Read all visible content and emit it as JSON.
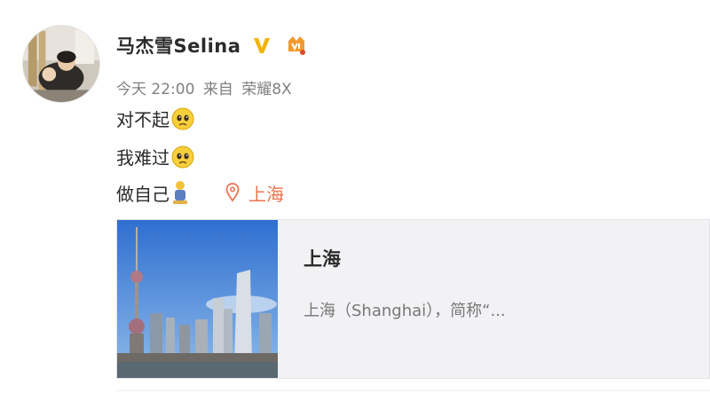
{
  "post": {
    "username": "马杰雪Selina",
    "meta": {
      "time": "今天 22:00",
      "source_prefix": "来自",
      "device": "荣耀8X"
    },
    "lines": [
      {
        "text": "对不起",
        "emoji": "sad-face-emoji"
      },
      {
        "text": "我难过",
        "emoji": "sad-face-emoji"
      },
      {
        "text": "做自己",
        "emoji": "person-emoji"
      }
    ],
    "location": {
      "icon": "location-pin-icon",
      "label": "上海"
    },
    "card": {
      "title": "上海",
      "description": "上海（Shanghai），简称“..."
    }
  },
  "colors": {
    "username": "#2b2b2b",
    "meta": "#808080",
    "location": "#eb7350",
    "card_bg": "#f2f2f5",
    "verified": "#f0b400"
  }
}
